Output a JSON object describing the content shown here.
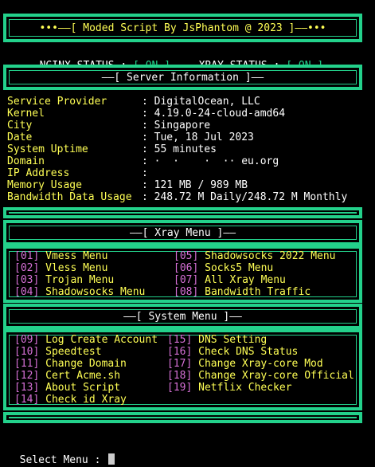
{
  "banner": "•••——[ Moded Script By JsPhantom @ 2023 ]——•••",
  "status": {
    "nginx_label": "NGINX STATUS : ",
    "nginx_value": "[ ON ]",
    "xray_label": "XRAY STATUS : ",
    "xray_value": "[ ON ]"
  },
  "server_info_title": "——[ Server Information ]——",
  "server_info": [
    {
      "label": "Service Provider",
      "value": "DigitalOcean, LLC"
    },
    {
      "label": "Kernel",
      "value": "4.19.0-24-cloud-amd64"
    },
    {
      "label": "City",
      "value": "Singapore"
    },
    {
      "label": "Date",
      "value": "Tue, 18 Jul 2023"
    },
    {
      "label": "System Uptime",
      "value": "55 minutes"
    },
    {
      "label": "Domain",
      "value": "·  ·    ·  ·· eu.org"
    },
    {
      "label": "IP Address",
      "value": ""
    },
    {
      "label": "Memory Usage",
      "value": "121 MB / 989 MB"
    },
    {
      "label": "Bandwidth Data Usage",
      "value": "248.72 M Daily/248.72 M Monthly"
    }
  ],
  "separator": ":",
  "xray_menu_title": "——[ Xray Menu ]——",
  "xray_menu": [
    {
      "num": "[01]",
      "label": "Vmess Menu"
    },
    {
      "num": "[02]",
      "label": "Vless Menu"
    },
    {
      "num": "[03]",
      "label": "Trojan Menu"
    },
    {
      "num": "[04]",
      "label": "Shadowsocks Menu"
    },
    {
      "num": "[05]",
      "label": "Shadowsocks 2022 Menu"
    },
    {
      "num": "[06]",
      "label": "Socks5 Menu"
    },
    {
      "num": "[07]",
      "label": "All Xray Menu"
    },
    {
      "num": "[08]",
      "label": "Bandwidth Traffic"
    }
  ],
  "system_menu_title": "——[ System Menu ]——",
  "system_menu": [
    {
      "num": "[09]",
      "label": "Log Create Account"
    },
    {
      "num": "[10]",
      "label": "Speedtest"
    },
    {
      "num": "[11]",
      "label": "Change Domain"
    },
    {
      "num": "[12]",
      "label": "Cert Acme.sh"
    },
    {
      "num": "[13]",
      "label": "About Script"
    },
    {
      "num": "[14]",
      "label": "Check id Xray"
    },
    {
      "num": "[15]",
      "label": "DNS Setting"
    },
    {
      "num": "[16]",
      "label": "Check DNS Status"
    },
    {
      "num": "[17]",
      "label": "Change Xray-core Mod"
    },
    {
      "num": "[18]",
      "label": "Change Xray-core Official"
    },
    {
      "num": "[19]",
      "label": "Netflix Checker"
    }
  ],
  "prompt": "Select Menu : ",
  "colors": {
    "border": "#23d18b",
    "label": "#ffff55",
    "number": "#d670d6",
    "text": "#ffffff"
  }
}
